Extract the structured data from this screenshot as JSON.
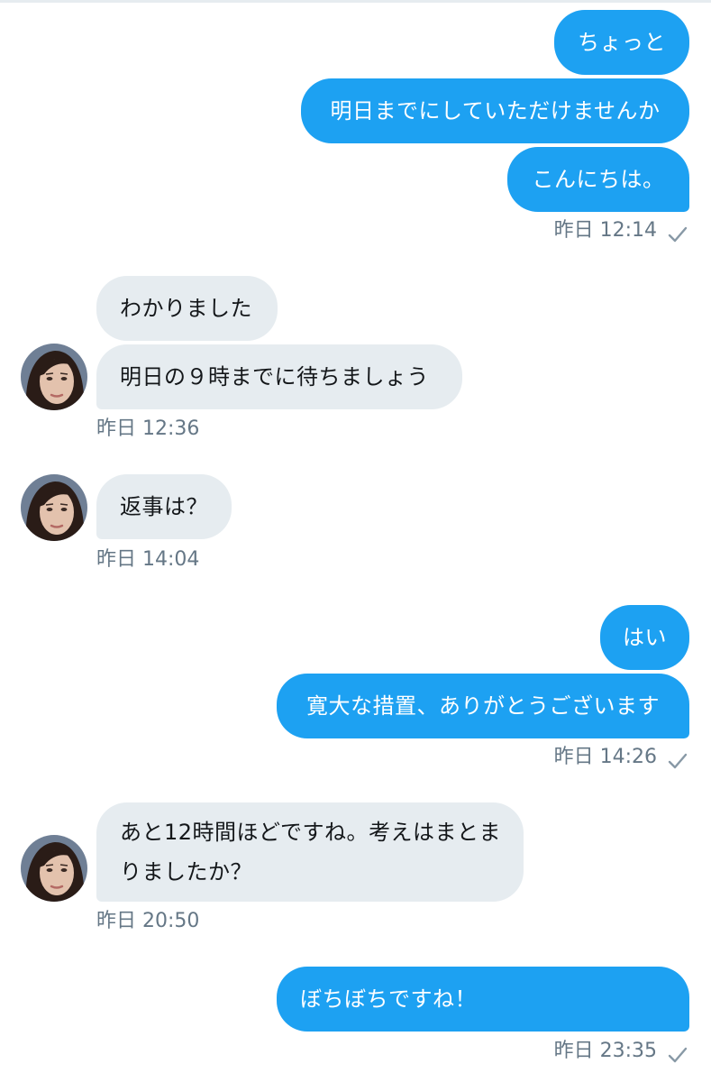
{
  "groups": [
    {
      "side": "outgoing",
      "messages": [
        "ちょっと",
        "明日までにしていただけませんか",
        "こんにちは。"
      ],
      "timestamp": "昨日 12:14",
      "read_icon": "check-icon"
    },
    {
      "side": "incoming",
      "messages": [
        "わかりました",
        "明日の９時までに待ちましょう"
      ],
      "timestamp": "昨日 12:36",
      "avatar": "avatar-woman"
    },
    {
      "side": "incoming",
      "messages": [
        "返事は？"
      ],
      "timestamp": "昨日 14:04",
      "avatar": "avatar-woman"
    },
    {
      "side": "outgoing",
      "messages": [
        "はい",
        "寛大な措置、ありがとうございます"
      ],
      "timestamp": "昨日 14:26",
      "read_icon": "check-icon"
    },
    {
      "side": "incoming",
      "messages": [
        "あと12時間ほどですね。考えはまとまりましたか？"
      ],
      "timestamp": "昨日 20:50",
      "avatar": "avatar-woman"
    },
    {
      "side": "outgoing",
      "messages": [
        "ぼちぼちですね！"
      ],
      "timestamp": "昨日 23:35",
      "read_icon": "check-icon"
    }
  ],
  "colors": {
    "outgoing_bubble": "#1da1f2",
    "incoming_bubble": "#e6ecf0",
    "timestamp": "#657786"
  }
}
